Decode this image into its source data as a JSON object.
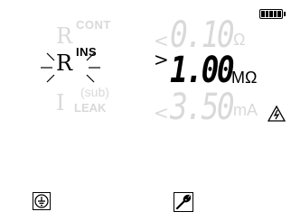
{
  "modes": {
    "cont": {
      "symbol": "R",
      "label": "CONT"
    },
    "ins": {
      "symbol": "R",
      "label": "INS"
    },
    "leak": {
      "symbol": "I",
      "label": "(sub)",
      "sub_label": "LEAK"
    }
  },
  "readings": {
    "cont": {
      "arrow": "<",
      "value": "0.10",
      "unit": "Ω"
    },
    "ins": {
      "arrow": ">",
      "value": "1.00",
      "unit": "MΩ"
    },
    "leak": {
      "arrow": "<",
      "value": "3.50",
      "unit": "mA"
    }
  },
  "status": {
    "battery_level": 1.0,
    "hazard_icon": "high-voltage-warning-icon",
    "ground_icon": "ground-icon",
    "settings_icon": "wrench-icon"
  },
  "colors": {
    "active": "#000000",
    "inactive": "#d9d9d9"
  }
}
